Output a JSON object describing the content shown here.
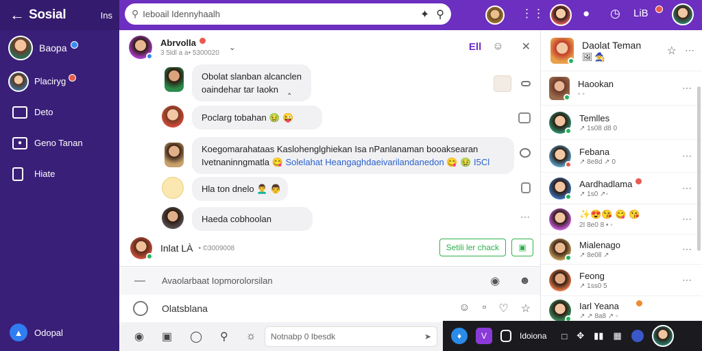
{
  "sidebar": {
    "brand": "Sosial",
    "header_label": "Ins",
    "profile_name": "Baopa",
    "items": [
      {
        "label": "Placiryg",
        "icon": "avatar-icon"
      },
      {
        "label": "Deto",
        "icon": "inbox-icon"
      },
      {
        "label": "Geno Tanan",
        "icon": "people-icon"
      },
      {
        "label": "Hiate",
        "icon": "page-icon"
      }
    ],
    "bottom_label": "Odopal"
  },
  "topbar": {
    "search_placeholder": "Ieboail Idennyhaalh",
    "badge_label": "LiB"
  },
  "chat": {
    "name": "Abrvolla",
    "subtitle": "3 5ldl a a• 5300020",
    "header_label": "Ell",
    "messages": [
      {
        "text": "Obolat slanban alcanclen",
        "text2": "oaindehar tar Iaokn",
        "mark": "‸"
      },
      {
        "text": "Poclarg tobahan 🤢 😜"
      },
      {
        "text": "Koegomarahataas Kaslohenglghiekan Isa nPanlanaman booaksearan",
        "text2a": "Ivetnaninngmatla 😋",
        "text2b": "Solelahat Heangaghdaeivarilandanedon",
        "text2c": "😋 🤢 I5Cl"
      },
      {
        "text": "Hla ton dnelo 👨‍🦱 👨"
      },
      {
        "text": "Haeda cobhoolan"
      }
    ],
    "compose_name": "Inlat LÀ",
    "compose_sub": "• ©3009008",
    "check_button": "Setili ler chack",
    "reply_placeholder": "Avaolarbaat Iopmorolorsilan",
    "input_placeholder": "Olatsblana",
    "tools_search": "Notnabp 0 Ibesdk"
  },
  "contacts": {
    "title": "Daolat Teman",
    "title_sub": "🖼 🧙",
    "list": [
      {
        "name": "Haookan",
        "sub": "◦ ◦"
      },
      {
        "name": "Temlles",
        "sub": "↗ 1s08 d8 0"
      },
      {
        "name": "Febana",
        "sub": "↗ 8e8d ↗ 0"
      },
      {
        "name": "Aardhadlama",
        "sub": "↗ 1s0 ↗◦"
      },
      {
        "name": "✨😍😘 😋 😘",
        "sub": "2I 8e0 8 • ◦"
      },
      {
        "name": "Mialenago",
        "sub": "↗ 8e0ll ↗"
      },
      {
        "name": "Feong",
        "sub": "↗ 1ss0 5"
      },
      {
        "name": "Iarl Yeana",
        "sub": "↗ ↗ 8a8 ↗ ◦"
      }
    ]
  },
  "taskbar": {
    "label": "Idoiona"
  }
}
